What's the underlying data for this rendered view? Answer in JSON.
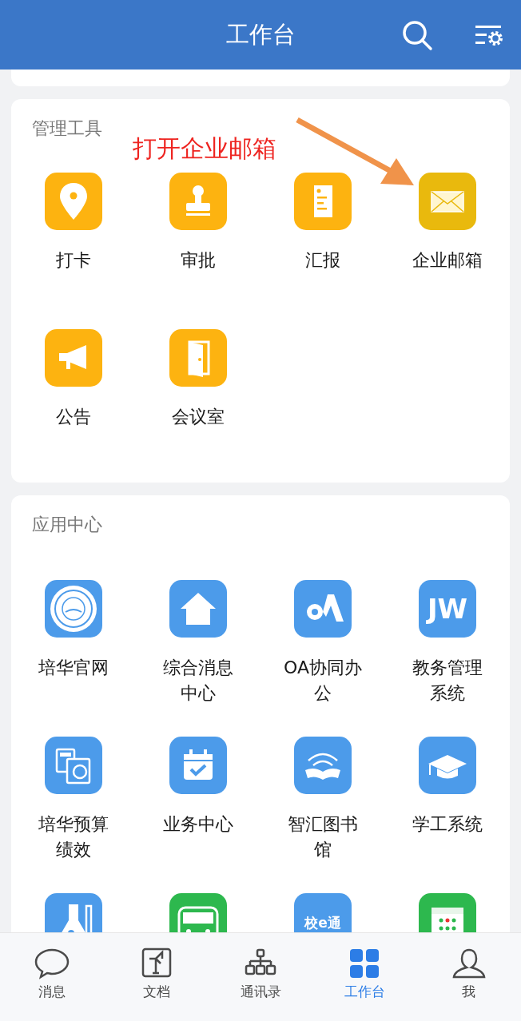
{
  "header": {
    "title": "工作台"
  },
  "annotation": {
    "text": "打开企业邮箱"
  },
  "sections": [
    {
      "title": "管理工具",
      "items": [
        {
          "label": "打卡",
          "color": "#fdb310"
        },
        {
          "label": "审批",
          "color": "#fdb310"
        },
        {
          "label": "汇报",
          "color": "#fdb310"
        },
        {
          "label": "企业邮箱",
          "color": "#e9b90d"
        },
        {
          "label": "公告",
          "color": "#fdb310"
        },
        {
          "label": "会议室",
          "color": "#fdb310"
        }
      ]
    },
    {
      "title": "应用中心",
      "items": [
        {
          "label": "培华官网",
          "color": "#4c9bea"
        },
        {
          "label": "综合消息中心",
          "color": "#4c9bea"
        },
        {
          "label": "OA协同办公",
          "color": "#4c9bea"
        },
        {
          "label": "教务管理系统",
          "color": "#4c9bea",
          "badge": "JW"
        },
        {
          "label": "培华预算绩效",
          "color": "#4c9bea"
        },
        {
          "label": "业务中心",
          "color": "#4c9bea"
        },
        {
          "label": "智汇图书馆",
          "color": "#4c9bea"
        },
        {
          "label": "学工系统",
          "color": "#4c9bea"
        },
        {
          "color": "#4c9bea"
        },
        {
          "color": "#2db84e"
        },
        {
          "color": "#4c9bea",
          "badge": "校e通"
        },
        {
          "color": "#2db84e"
        }
      ]
    }
  ],
  "tabs": [
    {
      "label": "消息",
      "selected": false
    },
    {
      "label": "文档",
      "selected": false
    },
    {
      "label": "通讯录",
      "selected": false
    },
    {
      "label": "工作台",
      "selected": true
    },
    {
      "label": "我",
      "selected": false
    }
  ]
}
